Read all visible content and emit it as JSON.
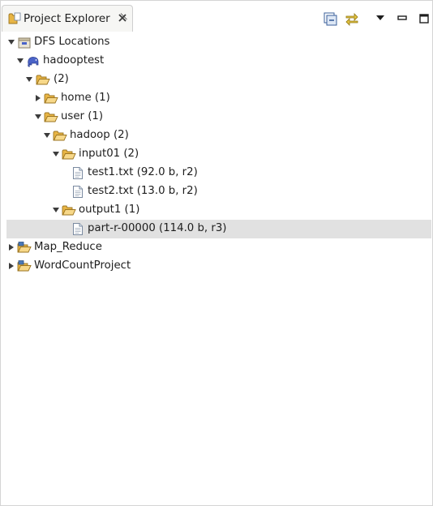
{
  "view": {
    "title": "Project Explorer"
  },
  "tree": {
    "dfs_locations": "DFS Locations",
    "hadooptest": "hadooptest",
    "root_dir": "(2)",
    "home": "home (1)",
    "user": "user (1)",
    "hadoop": "hadoop (2)",
    "input01": "input01 (2)",
    "test1": "test1.txt (92.0 b, r2)",
    "test2": "test2.txt (13.0 b, r2)",
    "output1": "output1 (1)",
    "part": "part-r-00000 (114.0 b, r3)",
    "map_reduce": "Map_Reduce",
    "wordcount": "WordCountProject"
  },
  "icons": {
    "view": "project-explorer-icon",
    "collapse_all": "collapse-all-icon",
    "link_editor": "link-with-editor-icon",
    "view_menu": "view-menu-icon",
    "minimize": "minimize-icon",
    "maximize": "maximize-icon",
    "folder": "folder-open-icon",
    "file": "file-icon",
    "elephant": "hadoop-elephant-icon",
    "project": "project-folder-icon",
    "dfs": "dfs-locations-icon"
  },
  "colors": {
    "selection": "#e1e1e1",
    "folder": "#f0c463",
    "project": "#4a79b8",
    "elephant": "#4a63c8"
  }
}
